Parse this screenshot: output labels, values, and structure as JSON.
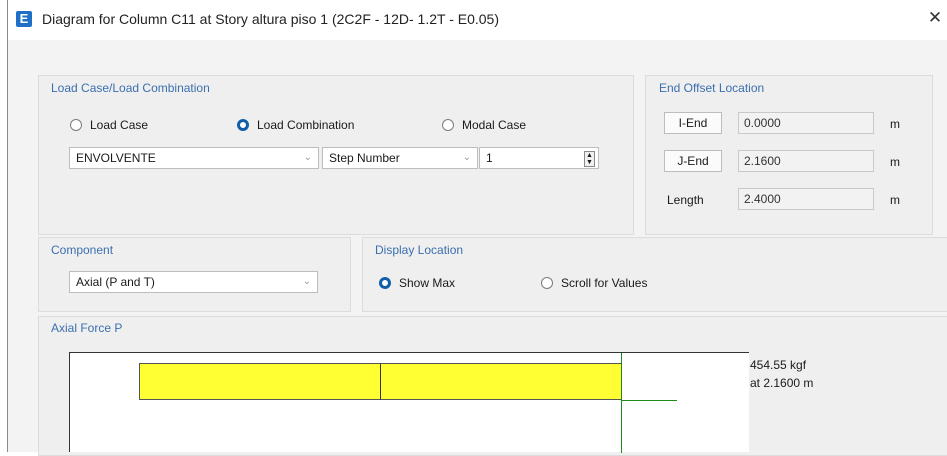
{
  "window": {
    "app_icon_letter": "E",
    "title": "Diagram for Column C11 at Story altura piso 1 (2C2F - 12D- 1.2T - E0.05)",
    "close_glyph": "✕"
  },
  "load_group": {
    "title": "Load Case/Load Combination",
    "radios": [
      {
        "label": "Load Case",
        "selected": false
      },
      {
        "label": "Load Combination",
        "selected": true
      },
      {
        "label": "Modal Case",
        "selected": false
      }
    ],
    "combo_value": "ENVOLVENTE",
    "step_label": "Step Number",
    "step_value": "1"
  },
  "offset_group": {
    "title": "End Offset Location",
    "i_end_button": "I-End",
    "i_end_value": "0.0000",
    "j_end_button": "J-End",
    "j_end_value": "2.1600",
    "length_label": "Length",
    "length_value": "2.4000",
    "unit": "m"
  },
  "component_group": {
    "title": "Component",
    "value": "Axial (P and T)"
  },
  "display_group": {
    "title": "Display Location",
    "show_max": "Show Max",
    "scroll_values": "Scroll for Values",
    "show_max_selected": true
  },
  "diagram": {
    "title": "Axial Force P",
    "value_text": "454.55 kgf",
    "location_text": "at 2.1600 m",
    "fill_color": "#ffff33",
    "marker_color": "#1a8c1a"
  }
}
